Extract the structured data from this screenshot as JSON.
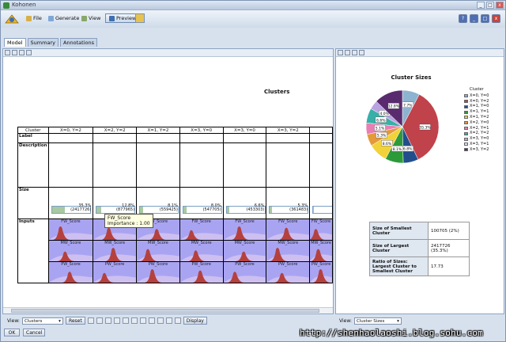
{
  "window": {
    "title": "Kohonen"
  },
  "toolbar": {
    "file_label": "File",
    "generate_label": "Generate",
    "view_label": "View",
    "preview_label": "Preview",
    "help_icons": [
      "?",
      "_",
      "□",
      "x"
    ]
  },
  "tabs": [
    {
      "label": "Model",
      "active": true
    },
    {
      "label": "Summary",
      "active": false
    },
    {
      "label": "Annotations",
      "active": false
    }
  ],
  "model": {
    "title": "Clusters",
    "header_label": "Cluster",
    "row_labels": {
      "label": "Label",
      "description": "Description",
      "size": "Size",
      "inputs": "Inputs"
    },
    "clusters": [
      {
        "name": "X=0, Y=2",
        "pct": "35.3%",
        "count": "(2417726)",
        "fill": 0.353
      },
      {
        "name": "X=2, Y=2",
        "pct": "12.8%",
        "count": "(877965)",
        "fill": 0.128
      },
      {
        "name": "X=1, Y=2",
        "pct": "8.1%",
        "count": "(559425)",
        "fill": 0.081
      },
      {
        "name": "X=3, Y=0",
        "pct": "8.0%",
        "count": "(547705)",
        "fill": 0.08
      },
      {
        "name": "X=3, Y=0",
        "pct": "6.6%",
        "count": "(453303)",
        "fill": 0.066
      },
      {
        "name": "X=3, Y=2",
        "pct": "5.3%",
        "count": "(361483)",
        "fill": 0.053
      },
      {
        "name": "",
        "pct": "",
        "count": "",
        "fill": 0.05
      }
    ],
    "inputs": [
      "FW_Score",
      "MW_Score",
      "PW_Score"
    ],
    "tooltip": {
      "line1": "FW_Score",
      "line2": "Importance : 1.00"
    }
  },
  "left_view": {
    "label": "View:",
    "selected": "Clusters",
    "reset_label": "Reset",
    "display_label": "Display"
  },
  "right_view": {
    "label": "View:",
    "selected": "Cluster Sizes"
  },
  "cluster_sizes": {
    "stats": [
      {
        "key": "Size of Smallest Cluster",
        "value": "100705 (2%)"
      },
      {
        "key": "Size of Largest Cluster",
        "value": "2417726 (35.3%)"
      },
      {
        "key": "Ratio of Sizes: Largest Cluster to Smallest Cluster",
        "value": "17.73"
      }
    ]
  },
  "chart_data": {
    "type": "pie",
    "title": "Cluster Sizes",
    "legend_title": "Cluster",
    "legend_position": "right",
    "slices": [
      {
        "name": "X=0, Y=0",
        "value": 7.7,
        "label": "7.7%",
        "color": "#8cb3cf"
      },
      {
        "name": "X=0, Y=2",
        "value": 35.3,
        "label": "35.3%",
        "color": "#c0424a"
      },
      {
        "name": "X=1, Y=0",
        "value": 6.8,
        "label": "6.8%",
        "color": "#224f8c"
      },
      {
        "name": "X=1, Y=2",
        "value": 8.1,
        "label": "8.1%",
        "color": "#2d9a3a"
      },
      {
        "name": "X=2, Y=1",
        "value": 8.6,
        "label": "8.6%",
        "color": "#f2d23a"
      },
      {
        "name": "X=1, Y=2",
        "value": 5.3,
        "label": "5.3%",
        "color": "#e39a3a"
      },
      {
        "name": "X=2, Y=1",
        "value": 5.1,
        "label": "5.1%",
        "color": "#e87fb4"
      },
      {
        "name": "X=2, Y=2",
        "value": 6.6,
        "label": "6.6%",
        "color": "#38b0a8"
      },
      {
        "name": "X=3, Y=0",
        "value": 4.0,
        "label": "4.0%",
        "color": "#b9a3e0"
      },
      {
        "name": "X=3, Y=1",
        "value": 12.8,
        "label": "12.8%",
        "color": "#5a2a6e"
      }
    ],
    "legend": [
      {
        "name": "X=0, Y=0",
        "color": "#8cb3cf"
      },
      {
        "name": "X=0, Y=2",
        "color": "#c0424a"
      },
      {
        "name": "X=1, Y=0",
        "color": "#224f8c"
      },
      {
        "name": "X=1, Y=1",
        "color": "#2d9a3a"
      },
      {
        "name": "X=1, Y=2",
        "color": "#f2d23a"
      },
      {
        "name": "X=2, Y=0",
        "color": "#e39a3a"
      },
      {
        "name": "X=2, Y=1",
        "color": "#e87fb4"
      },
      {
        "name": "X=2, Y=2",
        "color": "#38b0a8"
      },
      {
        "name": "X=3, Y=0",
        "color": "#b9a3e0"
      },
      {
        "name": "X=3, Y=1",
        "color": "#dbe6f5"
      },
      {
        "name": "X=3, Y=2",
        "color": "#5a2a6e"
      }
    ]
  },
  "buttons": {
    "ok_label": "OK",
    "cancel_label": "Cancel"
  },
  "watermark": "http://shenhaolaoshi.blog.sohu.com"
}
